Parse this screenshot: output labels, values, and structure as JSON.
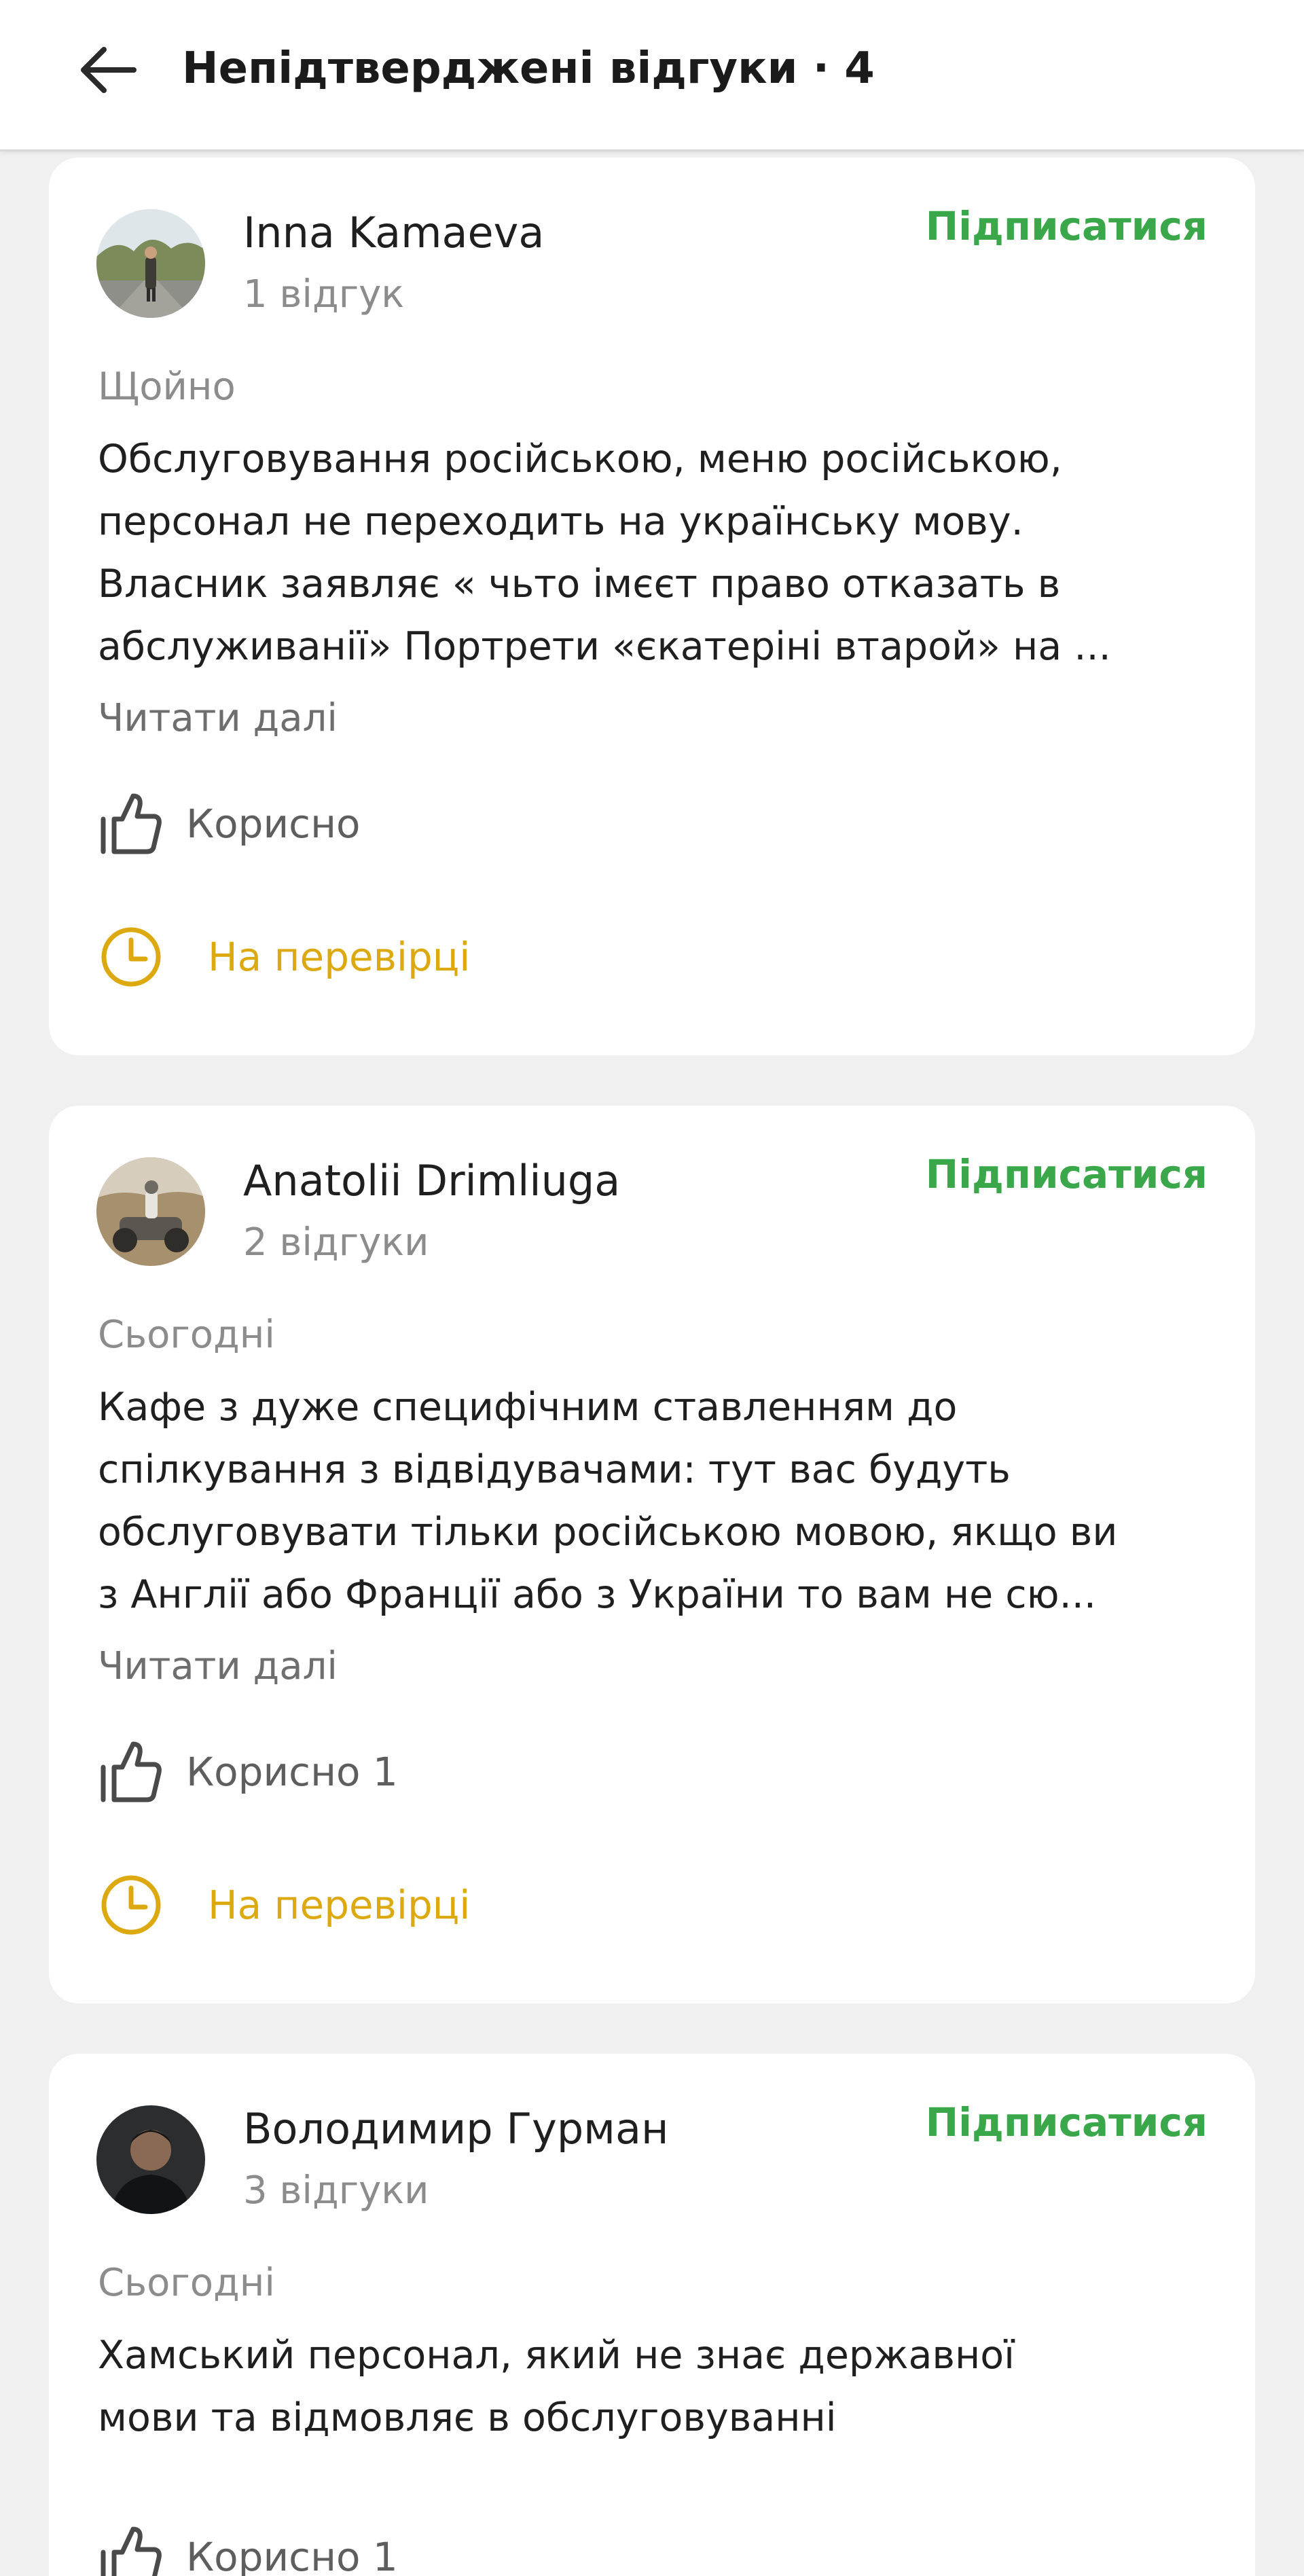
{
  "header": {
    "title": "Непідтверджені відгуки · 4"
  },
  "colors": {
    "subscribe": "#3aa84a",
    "pending": "#dcaa10",
    "secondary_text": "#8c8c8c",
    "background": "#f0f0f0"
  },
  "reviews": [
    {
      "author": "Inna Kamaeva",
      "review_count": "1 відгук",
      "subscribe_label": "Підписатися",
      "date": "Щойно",
      "text_lines": [
        "Обслуговування російською, меню російською,",
        "персонал не переходить на українську мову.",
        "Власник заявляє « чьто імєєт право отказать в",
        "абслуживанії» Портрети «єкатеріні втарой» на ..."
      ],
      "read_more": "Читати далі",
      "useful_label": "Корисно",
      "status_label": "На перевірці"
    },
    {
      "author": "Anatolii Drimliuga",
      "review_count": "2 відгуки",
      "subscribe_label": "Підписатися",
      "date": "Сьогодні",
      "text_lines": [
        "Кафе з дуже специфічним ставленням до",
        "спілкування з відвідувачами: тут вас будуть",
        "обслуговувати тільки російською мовою, якщо ви",
        "з Англії або Франції або з України то вам не сю..."
      ],
      "read_more": "Читати далі",
      "useful_label": "Корисно 1",
      "status_label": "На перевірці"
    },
    {
      "author": "Володимир Гурман",
      "review_count": "3 відгуки",
      "subscribe_label": "Підписатися",
      "date": "Сьогодні",
      "text_lines": [
        "Хамський персонал, який не знає державної",
        "мови та відмовляє в обслуговуванні"
      ],
      "useful_label": "Корисно 1"
    }
  ]
}
